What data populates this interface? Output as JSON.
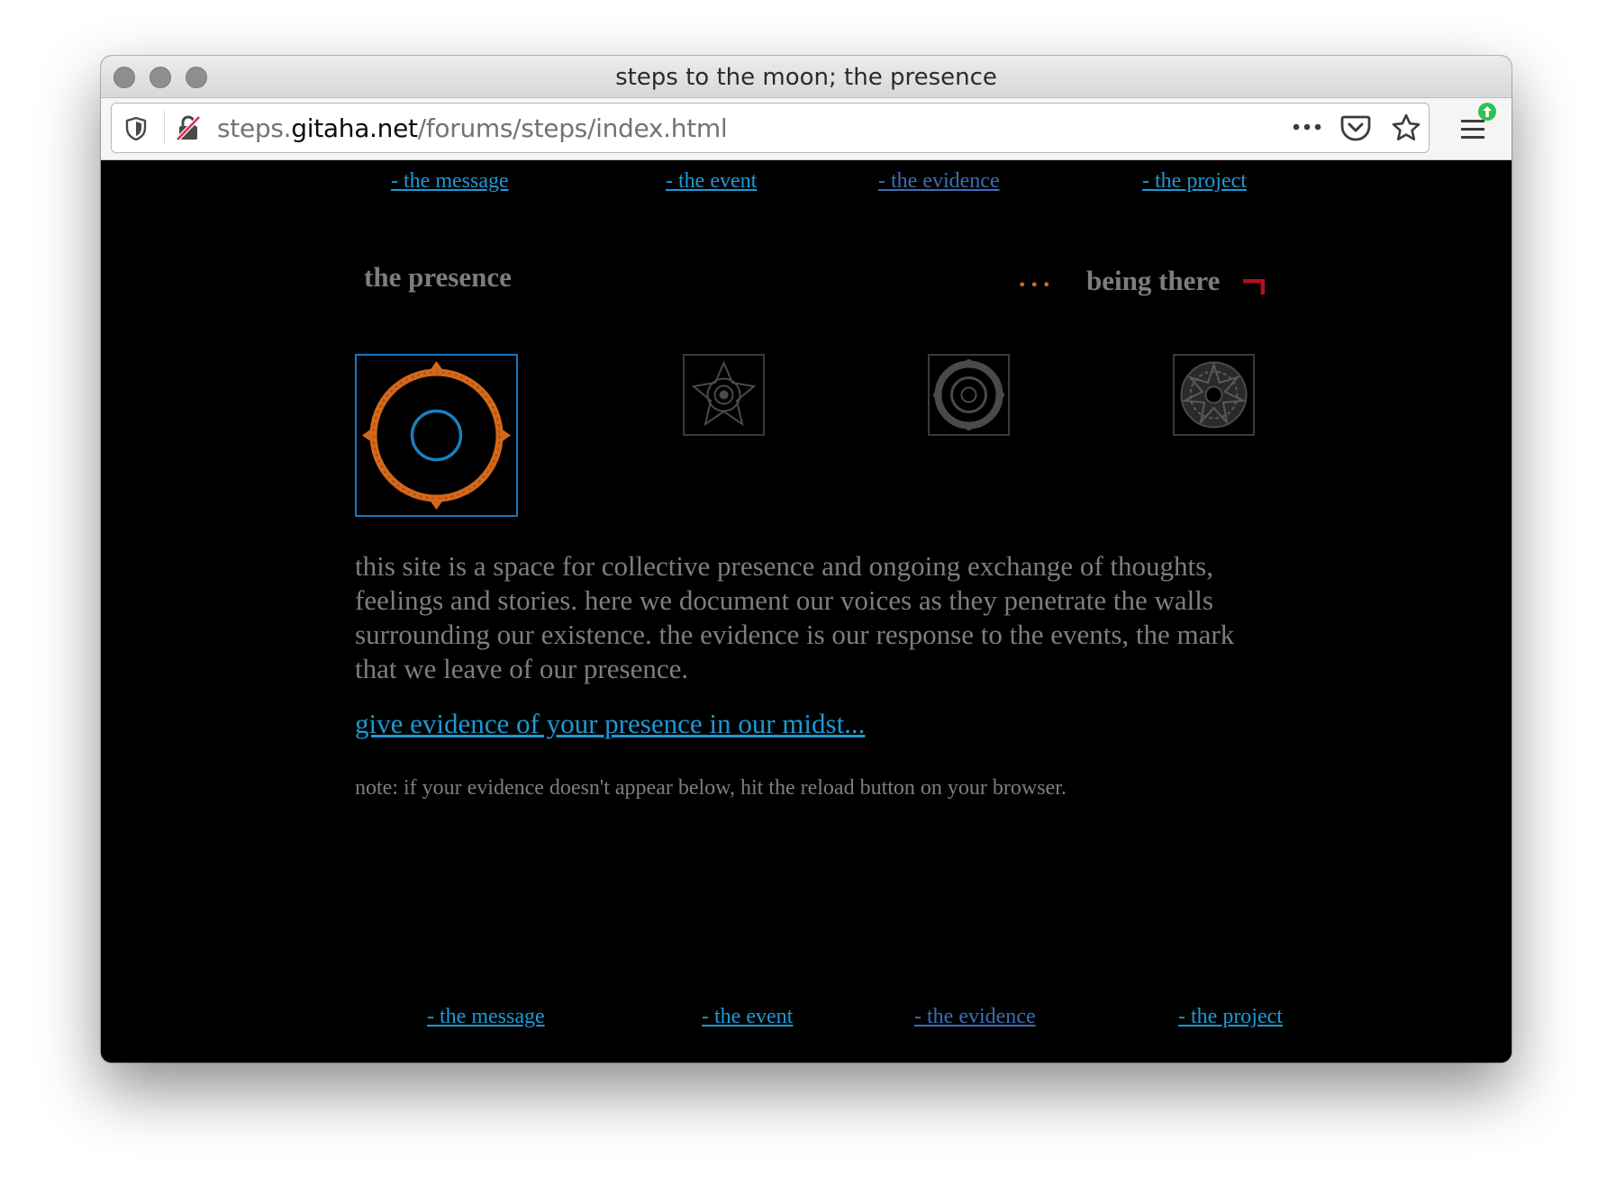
{
  "window": {
    "title": "steps to the moon; the presence"
  },
  "urlbar": {
    "url_prefix": "steps.",
    "url_domain": "gitaha.net",
    "url_path": "/forums/steps/index.html"
  },
  "nav_top": [
    {
      "label": "- the message"
    },
    {
      "label": "- the event"
    },
    {
      "label": "- the evidence"
    },
    {
      "label": "- the project"
    }
  ],
  "nav_bottom": [
    {
      "label": "- the message"
    },
    {
      "label": "- the event"
    },
    {
      "label": "- the evidence"
    },
    {
      "label": "- the project"
    }
  ],
  "page": {
    "heading": "the presence",
    "dots": "...",
    "tagline": "being there",
    "body": "this site is a space for collective presence and ongoing exchange of thoughts, feelings and stories. here we document our voices as they penetrate the walls surrounding our existence. the evidence is our response to the events, the mark that we leave of our presence.",
    "cta": "give evidence of your presence in our midst...",
    "note": "note: if your evidence doesn't appear below, hit the reload button on your browser."
  },
  "icons": {
    "tracking": "shield-icon",
    "insecure": "insecure-lock-icon",
    "more": "more-actions-icon",
    "pocket": "pocket-icon",
    "bookmark": "star-icon",
    "menu": "hamburger-menu-icon",
    "update": "update-badge-icon"
  },
  "colors": {
    "link": "#1a9ad6",
    "visited_link": "#3b6fb6",
    "accent_orange": "#d4681a",
    "accent_red": "#b0121b",
    "text_gray": "#7e7e7e"
  }
}
